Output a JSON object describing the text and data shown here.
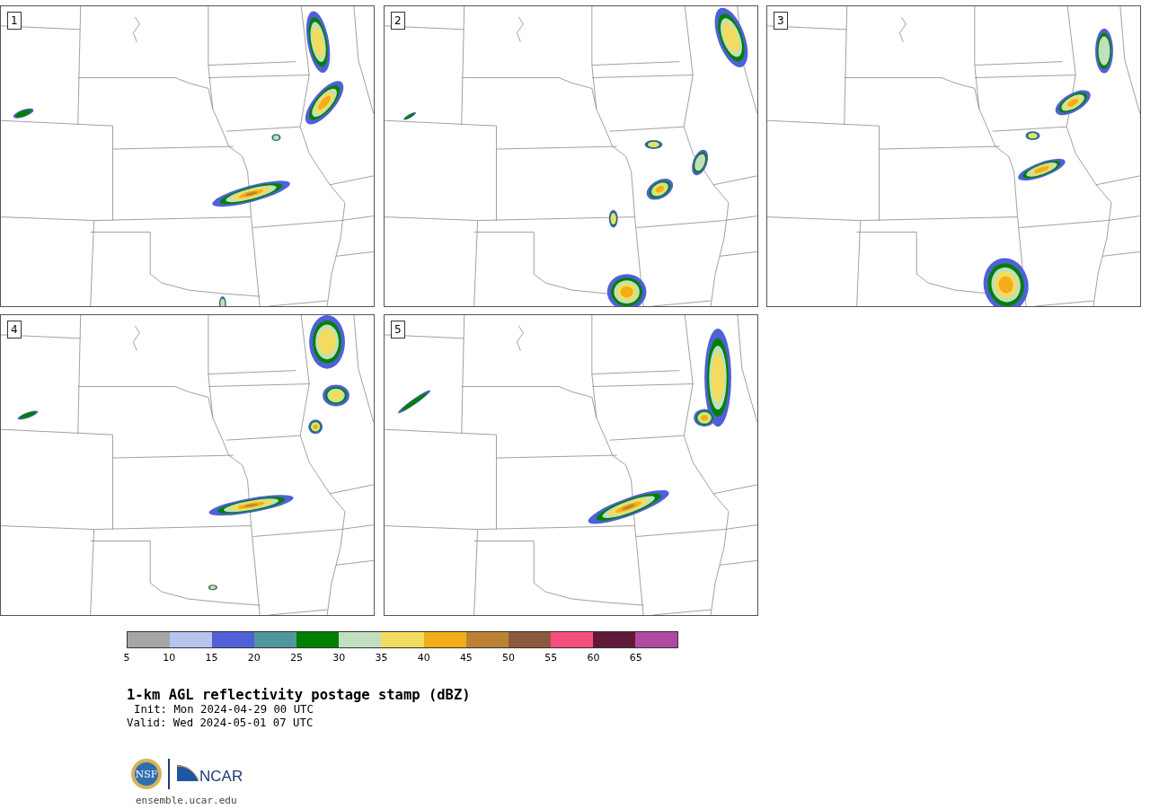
{
  "panels": [
    {
      "label": "1"
    },
    {
      "label": "2"
    },
    {
      "label": "3"
    },
    {
      "label": "4"
    },
    {
      "label": "5"
    }
  ],
  "colorbar": {
    "bins": [
      {
        "label": "5",
        "color": "#a6a6a6"
      },
      {
        "label": "10",
        "color": "#b8c3ee"
      },
      {
        "label": "15",
        "color": "#5060d6"
      },
      {
        "label": "20",
        "color": "#50979c"
      },
      {
        "label": "25",
        "color": "#008000"
      },
      {
        "label": "30",
        "color": "#c0dfbf"
      },
      {
        "label": "35",
        "color": "#f1dc60"
      },
      {
        "label": "40",
        "color": "#f2ad18"
      },
      {
        "label": "45",
        "color": "#bc8233"
      },
      {
        "label": "50",
        "color": "#8b5a3e"
      },
      {
        "label": "55",
        "color": "#f5507d"
      },
      {
        "label": "60",
        "color": "#601a38"
      },
      {
        "label": "65",
        "color": "#b04aa0"
      }
    ]
  },
  "title": "1-km AGL reflectivity postage stamp (dBZ)",
  "init": "Init: Mon 2024-04-29 00 UTC",
  "valid": "Valid: Wed 2024-05-01 07 UTC",
  "logos": {
    "nsf": "NSF",
    "ncar": "NCAR"
  },
  "footer": "ensemble.ucar.edu"
}
